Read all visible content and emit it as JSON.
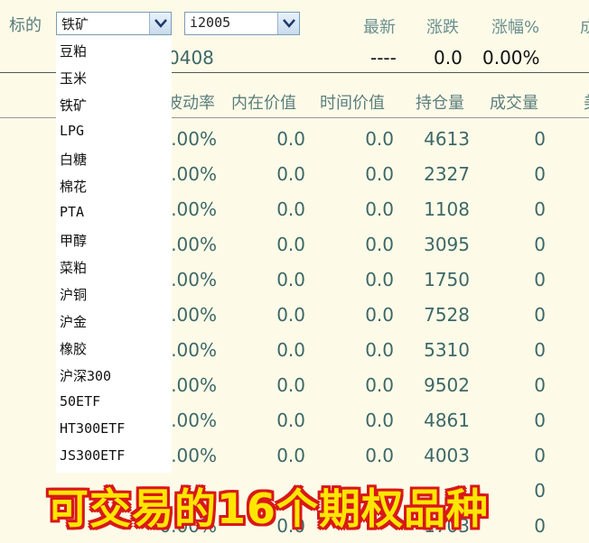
{
  "header": {
    "underlying_label": "标的",
    "underlying_select": "铁矿",
    "contract_select": "i2005",
    "latest_label": "最新",
    "change_label": "涨跌",
    "change_pct_label": "涨幅%",
    "cut_label": "成"
  },
  "quote": {
    "contract_partial": "0408",
    "latest": "----",
    "change": "0.0",
    "change_pct": "0.00%"
  },
  "table": {
    "columns": [
      "波动率",
      "内在价值",
      "时间价值",
      "持仓量",
      "成交量",
      "美"
    ],
    "rows": [
      {
        "vol": ".00%",
        "intrinsic": "0.0",
        "time": "0.0",
        "oi": "4613",
        "volume": "0"
      },
      {
        "vol": ".00%",
        "intrinsic": "0.0",
        "time": "0.0",
        "oi": "2327",
        "volume": "0"
      },
      {
        "vol": ".00%",
        "intrinsic": "0.0",
        "time": "0.0",
        "oi": "1108",
        "volume": "0"
      },
      {
        "vol": ".00%",
        "intrinsic": "0.0",
        "time": "0.0",
        "oi": "3095",
        "volume": "0"
      },
      {
        "vol": ".00%",
        "intrinsic": "0.0",
        "time": "0.0",
        "oi": "1750",
        "volume": "0"
      },
      {
        "vol": ".00%",
        "intrinsic": "0.0",
        "time": "0.0",
        "oi": "7528",
        "volume": "0"
      },
      {
        "vol": ".00%",
        "intrinsic": "0.0",
        "time": "0.0",
        "oi": "5310",
        "volume": "0"
      },
      {
        "vol": ".00%",
        "intrinsic": "0.0",
        "time": "0.0",
        "oi": "9502",
        "volume": "0"
      },
      {
        "vol": ".00%",
        "intrinsic": "0.0",
        "time": "0.0",
        "oi": "4861",
        "volume": "0"
      },
      {
        "vol": ".00%",
        "intrinsic": "0.0",
        "time": "0.0",
        "oi": "4003",
        "volume": "0"
      },
      {
        "vol": "",
        "intrinsic": "",
        "time": "",
        "oi": "",
        "volume": "0"
      },
      {
        "vol": "0.00%",
        "intrinsic": "0.0",
        "time": "",
        "oi": "1703",
        "volume": "0"
      }
    ]
  },
  "dropdown": {
    "items": [
      "豆粕",
      "玉米",
      "铁矿",
      "LPG",
      "白糖",
      "棉花",
      "PTA",
      "甲醇",
      "菜粕",
      "沪铜",
      "沪金",
      "橡胶",
      "沪深300",
      "50ETF",
      "HT300ETF",
      "JS300ETF"
    ]
  },
  "caption": "可交易的16个期权品种",
  "colors": {
    "background": "#fdfbe8",
    "caption_fill": "#ffe600",
    "caption_outline": "#d81818"
  }
}
